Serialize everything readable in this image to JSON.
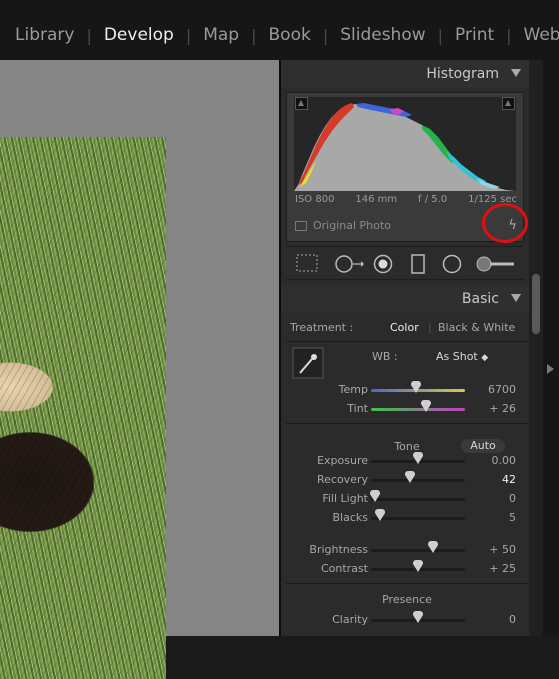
{
  "modules": [
    {
      "label": "Library",
      "active": false
    },
    {
      "label": "Develop",
      "active": true
    },
    {
      "label": "Map",
      "active": false
    },
    {
      "label": "Book",
      "active": false
    },
    {
      "label": "Slideshow",
      "active": false
    },
    {
      "label": "Print",
      "active": false
    },
    {
      "label": "Web",
      "active": false
    }
  ],
  "histogram": {
    "title": "Histogram",
    "iso": "ISO 800",
    "focal": "146 mm",
    "aperture": "f / 5.0",
    "shutter": "1/125 sec",
    "original_photo_label": "Original Photo"
  },
  "basic": {
    "title": "Basic",
    "treatment_label": "Treatment :",
    "treatment_color": "Color",
    "treatment_bw": "Black & White",
    "wb_label": "WB :",
    "wb_value": "As Shot",
    "tone_title": "Tone",
    "auto_label": "Auto",
    "presence_title": "Presence",
    "sliders": [
      {
        "label": "Temp",
        "value": "6700",
        "pos": 0.48
      },
      {
        "label": "Tint",
        "value": "+ 26",
        "pos": 0.58
      },
      {
        "label": "Exposure",
        "value": "0.00",
        "pos": 0.5
      },
      {
        "label": "Recovery",
        "value": "42",
        "pos": 0.42
      },
      {
        "label": "Fill Light",
        "value": "0",
        "pos": 0.04
      },
      {
        "label": "Blacks",
        "value": "5",
        "pos": 0.1
      },
      {
        "label": "Brightness",
        "value": "+ 50",
        "pos": 0.66
      },
      {
        "label": "Contrast",
        "value": "+ 25",
        "pos": 0.5
      },
      {
        "label": "Clarity",
        "value": "0",
        "pos": 0.5
      }
    ]
  },
  "colors": {
    "accent_red": "#e01010",
    "panel": "#2b2b2b"
  }
}
